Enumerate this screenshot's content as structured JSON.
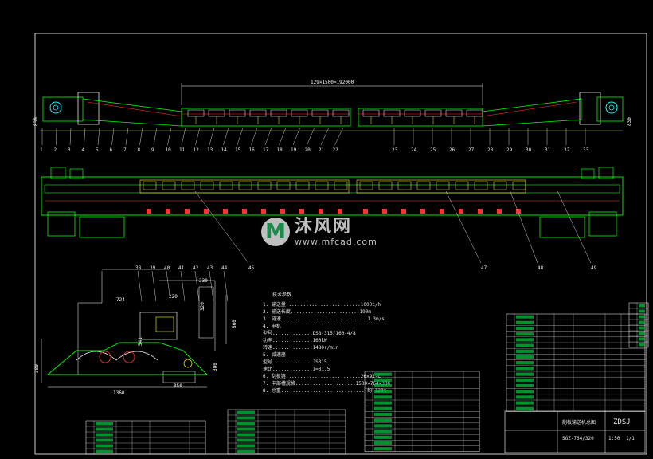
{
  "drawing": {
    "top_dimension": "129×1500=192000",
    "left_height": "830",
    "right_height": "830",
    "callouts_top": [
      "1",
      "2",
      "3",
      "4",
      "5",
      "6",
      "7",
      "8",
      "9",
      "10",
      "11",
      "12",
      "13",
      "14",
      "15",
      "16",
      "17",
      "18",
      "19",
      "20",
      "21",
      "22",
      "23",
      "24",
      "25",
      "26",
      "27",
      "28",
      "29",
      "30",
      "31",
      "32",
      "33"
    ],
    "callouts_mid": [
      "45",
      "47",
      "48",
      "49"
    ],
    "colors": {
      "background": "#000000",
      "frame": "#ffffff",
      "structure": "#00ff00",
      "detail": "#ffff00",
      "accent": "#ff3030",
      "cyan": "#00ffff",
      "magenta": "#ff40ff"
    }
  },
  "section_view": {
    "dim_724": "724",
    "dim_220": "220",
    "dim_230": "230",
    "dim_320": "320",
    "dim_860": "860",
    "dim_541": "541",
    "dim_380": "380",
    "dim_850": "850",
    "dim_1360": "1360",
    "dim_300": "300",
    "callouts": [
      "38",
      "39",
      "40",
      "41",
      "42",
      "43",
      "44"
    ]
  },
  "notes": {
    "header": "技术参数",
    "lines": [
      "1. 输送量..........................1000t/h",
      "2. 输送长度........................190m",
      "3. 链速..............................1.3m/s",
      "4. 电机",
      "   型号..............DSB-315/160-4/8",
      "   功率..............160kW",
      "   转速..............1480r/min",
      "5. 减速器",
      "   型号..............JS315",
      "   速比..............i=31.5",
      "6. 刮板链..........................26×92-C",
      "7. 中部槽规格.....................1500×764×300",
      "8. 总重..............................约 120t"
    ]
  },
  "title_block": {
    "company": "ZDSJ",
    "drawing_name": "刮板输送机总图",
    "drawing_no": "SGZ-764/320",
    "scale": "1:50",
    "sheet": "1/1"
  },
  "watermark": {
    "logo": "M",
    "name": "沐风网",
    "url": "www.mfcad.com"
  }
}
